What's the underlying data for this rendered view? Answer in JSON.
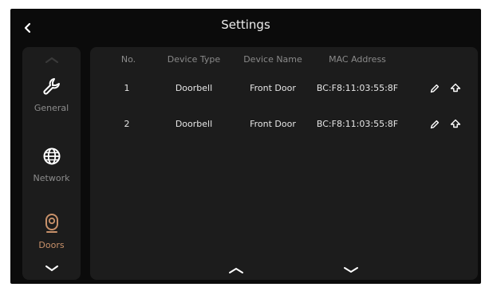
{
  "header": {
    "title": "Settings"
  },
  "sidebar": {
    "items": [
      {
        "label": "General",
        "icon": "wrench-icon"
      },
      {
        "label": "Network",
        "icon": "globe-icon"
      },
      {
        "label": "Doors",
        "icon": "doorbell-icon",
        "active": true
      }
    ]
  },
  "table": {
    "columns": [
      "No.",
      "Device Type",
      "Device Name",
      "MAC Address"
    ],
    "rows": [
      {
        "no": "1",
        "type": "Doorbell",
        "name": "Front Door",
        "mac": "BC:F8:11:03:55:8F"
      },
      {
        "no": "2",
        "type": "Doorbell",
        "name": "Front Door",
        "mac": "BC:F8:11:03:55:8F"
      }
    ]
  },
  "colors": {
    "background": "#0b0b0b",
    "panel": "#1c1c1c",
    "text": "#e6e6e6",
    "muted": "#8a8a8a",
    "accent": "#c8916a"
  }
}
